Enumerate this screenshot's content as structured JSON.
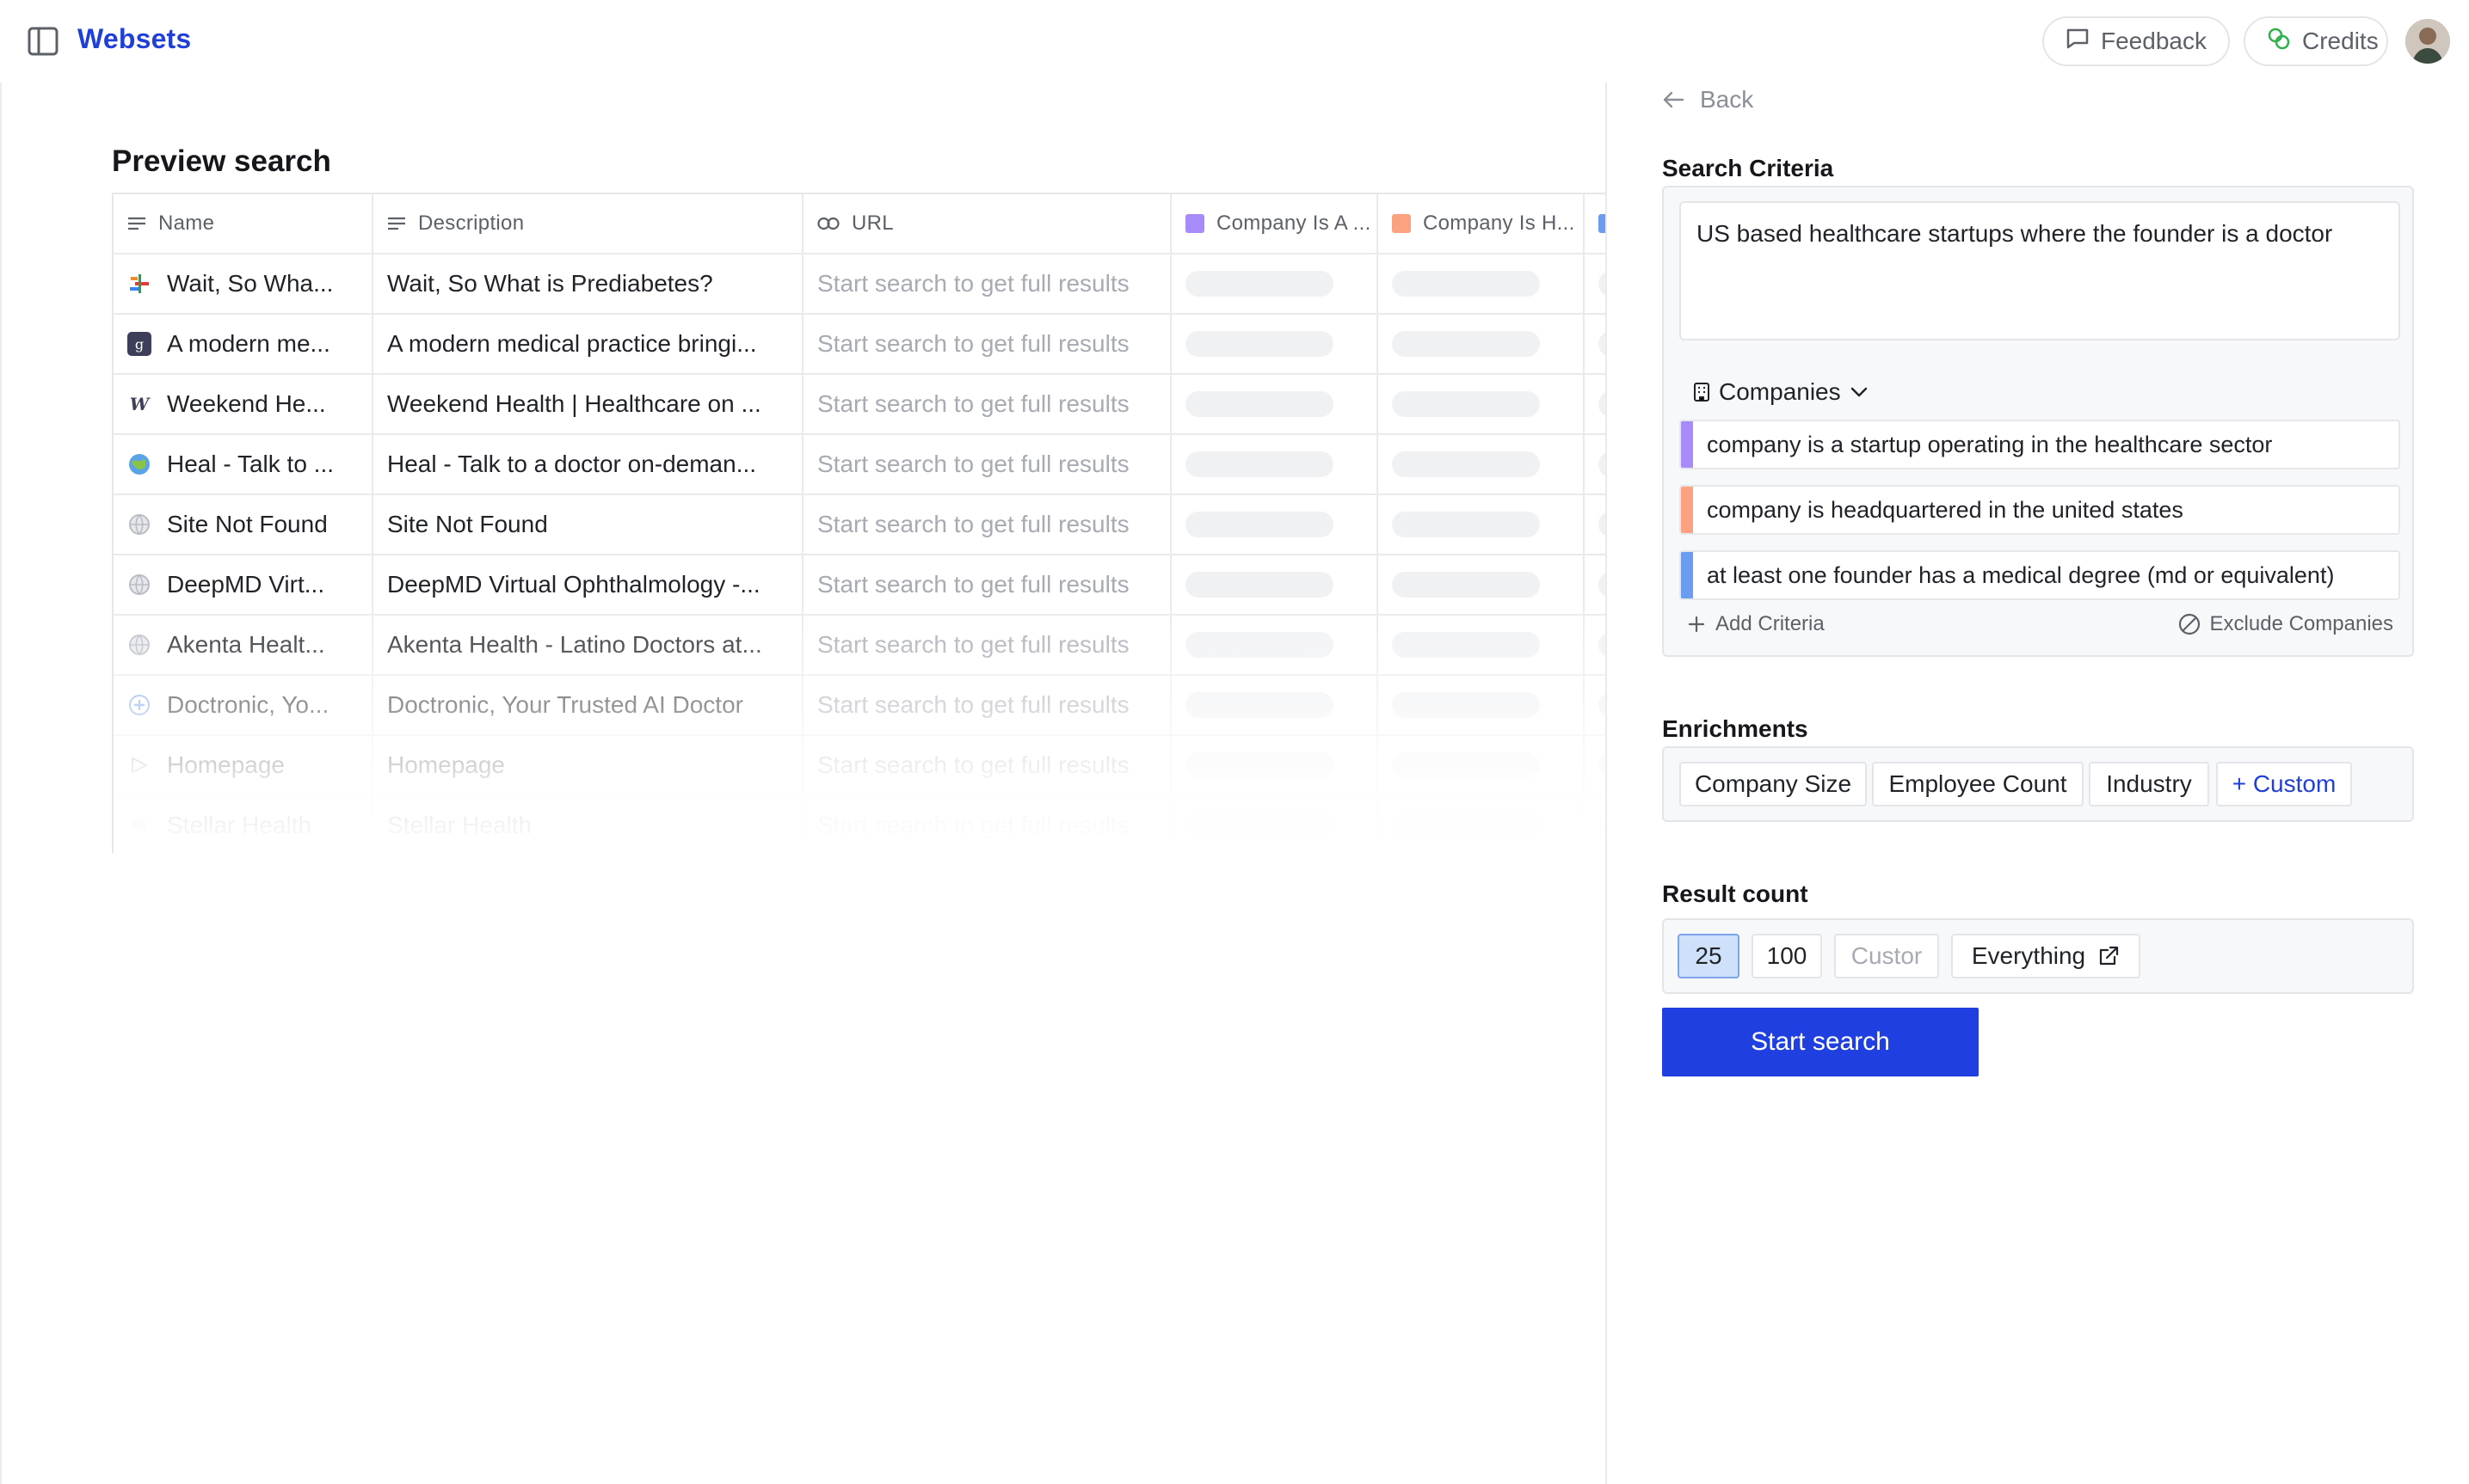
{
  "app": {
    "title": "Websets"
  },
  "topbar": {
    "feedback_label": "Feedback",
    "credits_label": "Credits"
  },
  "preview": {
    "title": "Preview search",
    "columns": [
      {
        "label": "Name",
        "icon": "text-lines-icon"
      },
      {
        "label": "Description",
        "icon": "text-lines-icon"
      },
      {
        "label": "URL",
        "icon": "link-icon"
      },
      {
        "label": "Company Is A ...",
        "color": "#a78bfa"
      },
      {
        "label": "Company Is H...",
        "color": "#fba380"
      },
      {
        "label": "",
        "color": "#6b9cf0"
      }
    ],
    "rows": [
      {
        "name": "Wait, So Wha...",
        "description": "Wait, So What is Prediabetes?",
        "url": "Start search to get full results",
        "icon": "colorful-bars-favicon"
      },
      {
        "name": "A modern me...",
        "description": "A modern medical practice bringi...",
        "url": "Start search to get full results",
        "icon": "g-square-favicon"
      },
      {
        "name": "Weekend He...",
        "description": "Weekend Health | Healthcare on ...",
        "url": "Start search to get full results",
        "icon": "w-logo-favicon"
      },
      {
        "name": "Heal - Talk to ...",
        "description": "Heal - Talk to a doctor on-deman...",
        "url": "Start search to get full results",
        "icon": "globe-colorful-favicon"
      },
      {
        "name": "Site Not Found",
        "description": "Site Not Found",
        "url": "Start search to get full results",
        "icon": "globe-icon"
      },
      {
        "name": "DeepMD Virt...",
        "description": "DeepMD Virtual Ophthalmology -...",
        "url": "Start search to get full results",
        "icon": "globe-icon"
      },
      {
        "name": "Akenta Healt...",
        "description": "Akenta Health - Latino Doctors at...",
        "url": "Start search to get full results",
        "icon": "globe-icon"
      },
      {
        "name": "Doctronic, Yo...",
        "description": "Doctronic, Your Trusted AI Doctor",
        "url": "Start search to get full results",
        "icon": "plus-circle-favicon"
      },
      {
        "name": "Homepage",
        "description": "Homepage",
        "url": "Start search to get full results",
        "icon": "arrow-favicon"
      },
      {
        "name": "Stellar Health",
        "description": "Stellar Health",
        "url": "Start search to get full results",
        "icon": "dot-favicon"
      }
    ]
  },
  "panel": {
    "back_label": "Back",
    "search_criteria_label": "Search Criteria",
    "query": "US based healthcare startups where the founder is a doctor",
    "entity_type": "Companies",
    "criteria": [
      {
        "text": "company is a startup operating in the healthcare sector",
        "color": "#a78bfa"
      },
      {
        "text": "company is headquartered in the united states",
        "color": "#fba380"
      },
      {
        "text": "at least one founder has a medical degree (md or equivalent)",
        "color": "#6b9cf0"
      }
    ],
    "add_criteria_label": "Add Criteria",
    "exclude_companies_label": "Exclude Companies",
    "enrichments_label": "Enrichments",
    "enrichments": [
      "Company Size",
      "Employee Count",
      "Industry"
    ],
    "custom_enrichment_label": "+ Custom",
    "result_count_label": "Result count",
    "result_options": [
      "25",
      "100"
    ],
    "selected_result": "25",
    "custom_count_placeholder": "Custor",
    "everything_label": "Everything",
    "start_search_label": "Start search"
  }
}
